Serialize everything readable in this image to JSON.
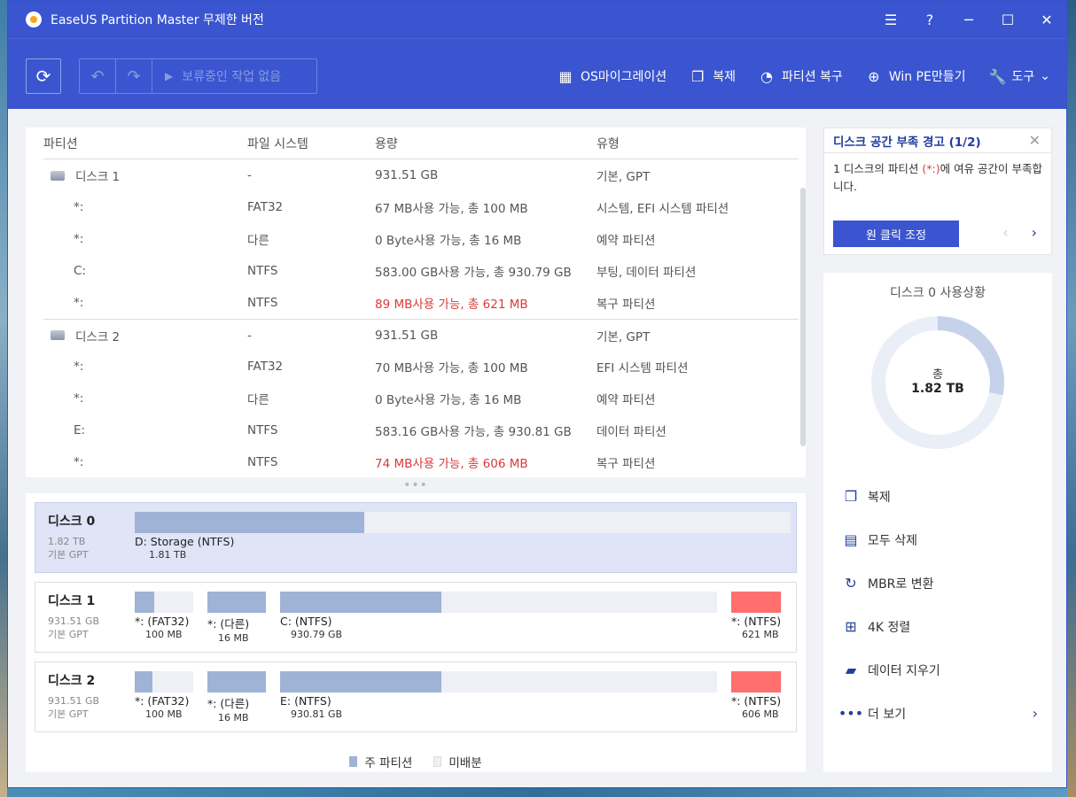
{
  "window": {
    "title": "EaseUS Partition Master 무제한 버전"
  },
  "toolbar": {
    "pending_label": "보류중인 작업 없음",
    "menu": [
      {
        "label": "OS마이그레이션",
        "icon": "windows-icon"
      },
      {
        "label": "복제",
        "icon": "clone-icon"
      },
      {
        "label": "파티션 복구",
        "icon": "pie-icon"
      },
      {
        "label": "Win PE만들기",
        "icon": "plus-circle-icon"
      },
      {
        "label": "도구",
        "icon": "wrench-icon"
      }
    ]
  },
  "table": {
    "headers": [
      "파티션",
      "파일 시스템",
      "용량",
      "유형"
    ],
    "disks": [
      {
        "name": "디스크 1",
        "fs": "-",
        "capacity": "931.51 GB",
        "type": "기본, GPT",
        "partitions": [
          {
            "name": "*:",
            "fs": "FAT32",
            "capacity": "67 MB사용 가능, 총 100 MB",
            "type": "시스템, EFI 시스템 파티션",
            "warn": false
          },
          {
            "name": "*:",
            "fs": "다른",
            "capacity": "0 Byte사용 가능, 총 16 MB",
            "type": "예약 파티션",
            "warn": false
          },
          {
            "name": "C:",
            "fs": "NTFS",
            "capacity": "583.00 GB사용 가능, 총 930.79 GB",
            "type": "부팅, 데이터 파티션",
            "warn": false
          },
          {
            "name": "*:",
            "fs": "NTFS",
            "capacity": "89 MB사용 가능, 총 621 MB",
            "type": "복구 파티션",
            "warn": true
          }
        ]
      },
      {
        "name": "디스크 2",
        "fs": "-",
        "capacity": "931.51 GB",
        "type": "기본, GPT",
        "partitions": [
          {
            "name": "*:",
            "fs": "FAT32",
            "capacity": "70 MB사용 가능, 총 100 MB",
            "type": "EFI 시스템 파티션",
            "warn": false
          },
          {
            "name": "*:",
            "fs": "다른",
            "capacity": "0 Byte사용 가능, 총 16 MB",
            "type": "예약 파티션",
            "warn": false
          },
          {
            "name": "E:",
            "fs": "NTFS",
            "capacity": "583.16 GB사용 가능, 총 930.81 GB",
            "type": "데이터 파티션",
            "warn": false
          },
          {
            "name": "*:",
            "fs": "NTFS",
            "capacity": "74 MB사용 가능, 총 606 MB",
            "type": "복구 파티션",
            "warn": true
          }
        ]
      }
    ]
  },
  "disk_map": [
    {
      "name": "디스크 0",
      "size": "1.82 TB",
      "type": "기본 GPT",
      "selected": true,
      "partitions": [
        {
          "label": "D: Storage (NTFS)",
          "size": "1.81 TB",
          "used": 0.35
        }
      ]
    },
    {
      "name": "디스크 1",
      "size": "931.51 GB",
      "type": "기본 GPT",
      "selected": false,
      "partitions": [
        {
          "label": "*: (FAT32)",
          "size": "100 MB",
          "used": 0.33
        },
        {
          "label": "*: (다른)",
          "size": "16 MB",
          "used": 1.0
        },
        {
          "label": "C: (NTFS)",
          "size": "930.79 GB",
          "used": 0.37
        },
        {
          "label": "*: (NTFS)",
          "size": "621 MB",
          "used": 0.98,
          "recovery": true
        }
      ]
    },
    {
      "name": "디스크 2",
      "size": "931.51 GB",
      "type": "기본 GPT",
      "selected": false,
      "partitions": [
        {
          "label": "*: (FAT32)",
          "size": "100 MB",
          "used": 0.3
        },
        {
          "label": "*: (다른)",
          "size": "16 MB",
          "used": 1.0
        },
        {
          "label": "E: (NTFS)",
          "size": "930.81 GB",
          "used": 0.37
        },
        {
          "label": "*: (NTFS)",
          "size": "606 MB",
          "used": 0.98,
          "recovery": true
        }
      ]
    }
  ],
  "legend": {
    "primary": "주 파티션",
    "unallocated": "미배분"
  },
  "warning": {
    "title": "디스크 공간 부족 경고 (1/2)",
    "body_prefix": "1 디스크의 파티션 ",
    "body_highlight": "(*:)",
    "body_suffix": "에 여유 공간이 부족합니다.",
    "button": "원 클릭 조정"
  },
  "usage": {
    "title": "디스크 0 사용상황",
    "center_label": "총",
    "center_value": "1.82 TB",
    "used_fraction": 0.28
  },
  "actions": [
    {
      "label": "복제",
      "icon": "clone-icon"
    },
    {
      "label": "모두 삭제",
      "icon": "delete-all-icon"
    },
    {
      "label": "MBR로 변환",
      "icon": "convert-mbr-icon"
    },
    {
      "label": "4K 정렬",
      "icon": "4k-align-icon"
    },
    {
      "label": "데이터 지우기",
      "icon": "wipe-data-icon"
    },
    {
      "label": "더 보기",
      "icon": "more-icon"
    }
  ],
  "colors": {
    "accent": "#3a55cf",
    "used": "#9fb3d6",
    "recovery": "#ff6f6f",
    "warn_text": "#d93a3a"
  }
}
